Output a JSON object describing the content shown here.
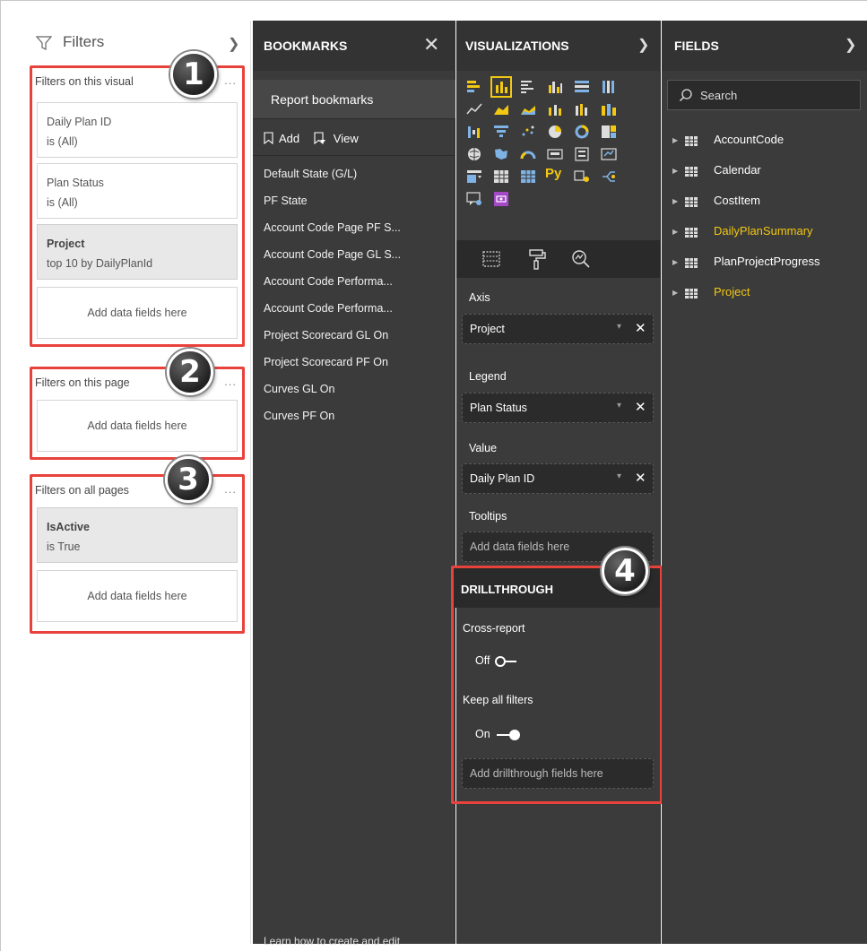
{
  "filters": {
    "title": "Filters",
    "sections": [
      {
        "title": "Filters on this visual",
        "badge": "1",
        "cards": [
          {
            "name": "Daily Plan ID",
            "value": "is (All)",
            "active": false
          },
          {
            "name": "Plan Status",
            "value": "is (All)",
            "active": false
          },
          {
            "name": "Project",
            "value": "top 10 by DailyPlanId",
            "active": true
          }
        ],
        "add_label": "Add data fields here"
      },
      {
        "title": "Filters on this page",
        "badge": "2",
        "cards": [],
        "add_label": "Add data fields here"
      },
      {
        "title": "Filters on all pages",
        "badge": "3",
        "cards": [
          {
            "name": "IsActive",
            "value": "is True",
            "active": true
          }
        ],
        "add_label": "Add data fields here"
      }
    ],
    "more": "..."
  },
  "bookmarks": {
    "title": "BOOKMARKS",
    "tab": "Report bookmarks",
    "add_label": "Add",
    "view_label": "View",
    "items": [
      "Default State (G/L)",
      "PF State",
      "Account Code Page PF S...",
      "Account Code Page GL S...",
      "Account Code Performa...",
      "Account Code Performa...",
      "Project Scorecard GL On",
      "Project Scorecard PF On",
      "Curves GL On",
      "Curves PF On"
    ],
    "footer": "Learn how to create and edit"
  },
  "visualizations": {
    "title": "VISUALIZATIONS",
    "python_label": "Py",
    "wells": [
      {
        "label": "Axis",
        "value": "Project"
      },
      {
        "label": "Legend",
        "value": "Plan Status"
      },
      {
        "label": "Value",
        "value": "Daily Plan ID"
      },
      {
        "label": "Tooltips",
        "value": "Add data fields here"
      }
    ],
    "drillthrough": {
      "title": "DRILLTHROUGH",
      "badge": "4",
      "cross_report_label": "Cross-report",
      "cross_report_state": "Off",
      "keep_filters_label": "Keep all filters",
      "keep_filters_state": "On",
      "add_label": "Add drillthrough fields here"
    }
  },
  "fields": {
    "title": "FIELDS",
    "search_placeholder": "Search",
    "tables": [
      {
        "name": "AccountCode",
        "highlight": false
      },
      {
        "name": "Calendar",
        "highlight": false
      },
      {
        "name": "CostItem",
        "highlight": false
      },
      {
        "name": "DailyPlanSummary",
        "highlight": true
      },
      {
        "name": "PlanProjectProgress",
        "highlight": false
      },
      {
        "name": "Project",
        "highlight": true
      }
    ]
  },
  "colors": {
    "annotation_red": "#e8423c",
    "accent_yellow": "#f2c811",
    "pane_dark": "#3b3b3b"
  }
}
